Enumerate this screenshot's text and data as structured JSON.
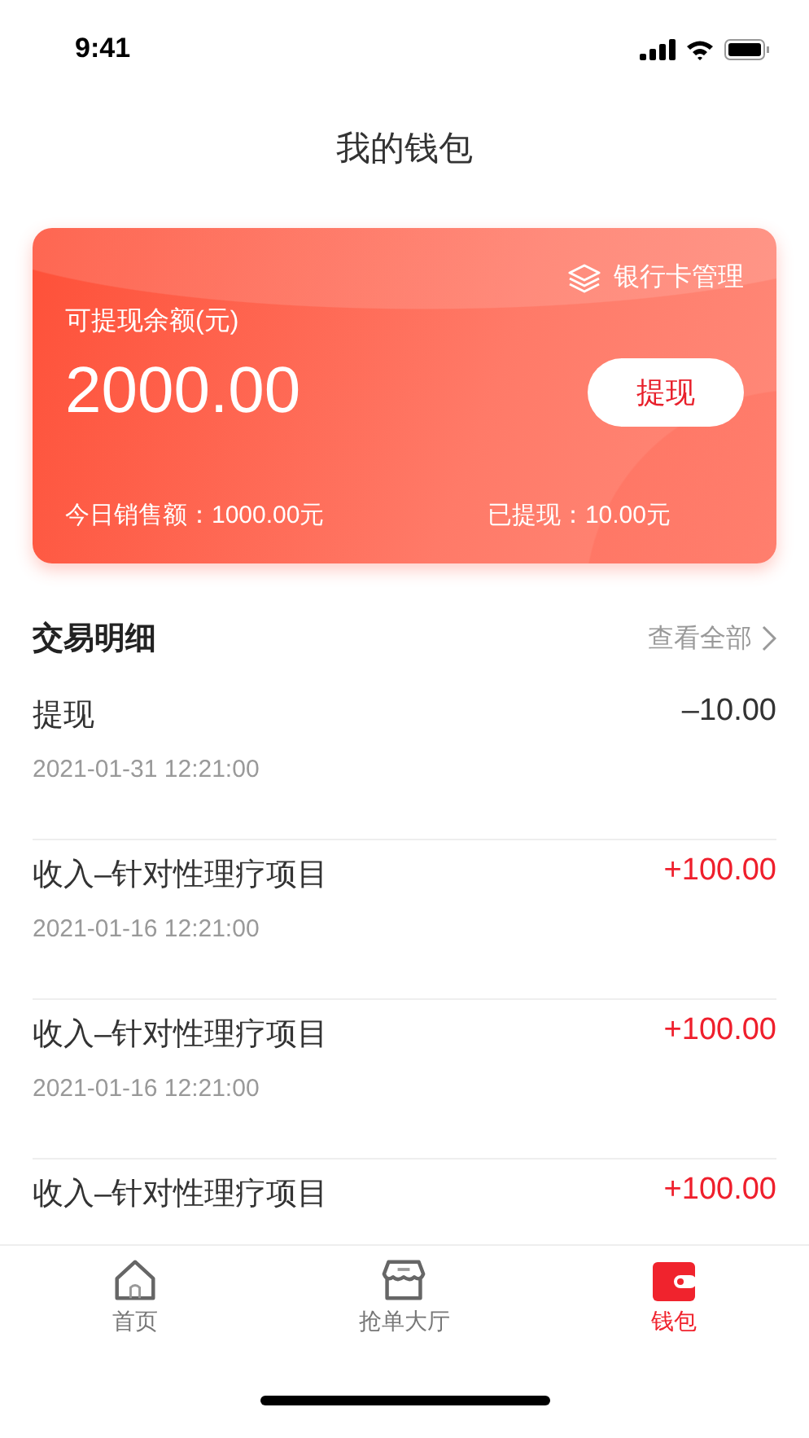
{
  "status_bar": {
    "time": "9:41"
  },
  "title": "我的钱包",
  "wallet_card": {
    "bank_link": "银行卡管理",
    "balance_label": "可提现余额(元)",
    "balance": "2000.00",
    "withdraw_button": "提现",
    "today_sales": "今日销售额：1000.00元",
    "withdrawn": "已提现：10.00元"
  },
  "transactions": {
    "title": "交易明细",
    "view_all": "查看全部",
    "rows": [
      {
        "title": "提现",
        "time": "2021-01-31 12:21:00",
        "amount": "–10.00",
        "kind": "out"
      },
      {
        "title": "收入–针对性理疗项目",
        "time": "2021-01-16 12:21:00",
        "amount": "+100.00",
        "kind": "in"
      },
      {
        "title": "收入–针对性理疗项目",
        "time": "2021-01-16 12:21:00",
        "amount": "+100.00",
        "kind": "in"
      },
      {
        "title": "收入–针对性理疗项目",
        "amount": "+100.00",
        "kind": "in"
      }
    ]
  },
  "tab_bar": [
    {
      "label": "首页",
      "selected": false
    },
    {
      "label": "抢单大厅",
      "selected": false
    },
    {
      "label": "钱包",
      "selected": true
    }
  ]
}
